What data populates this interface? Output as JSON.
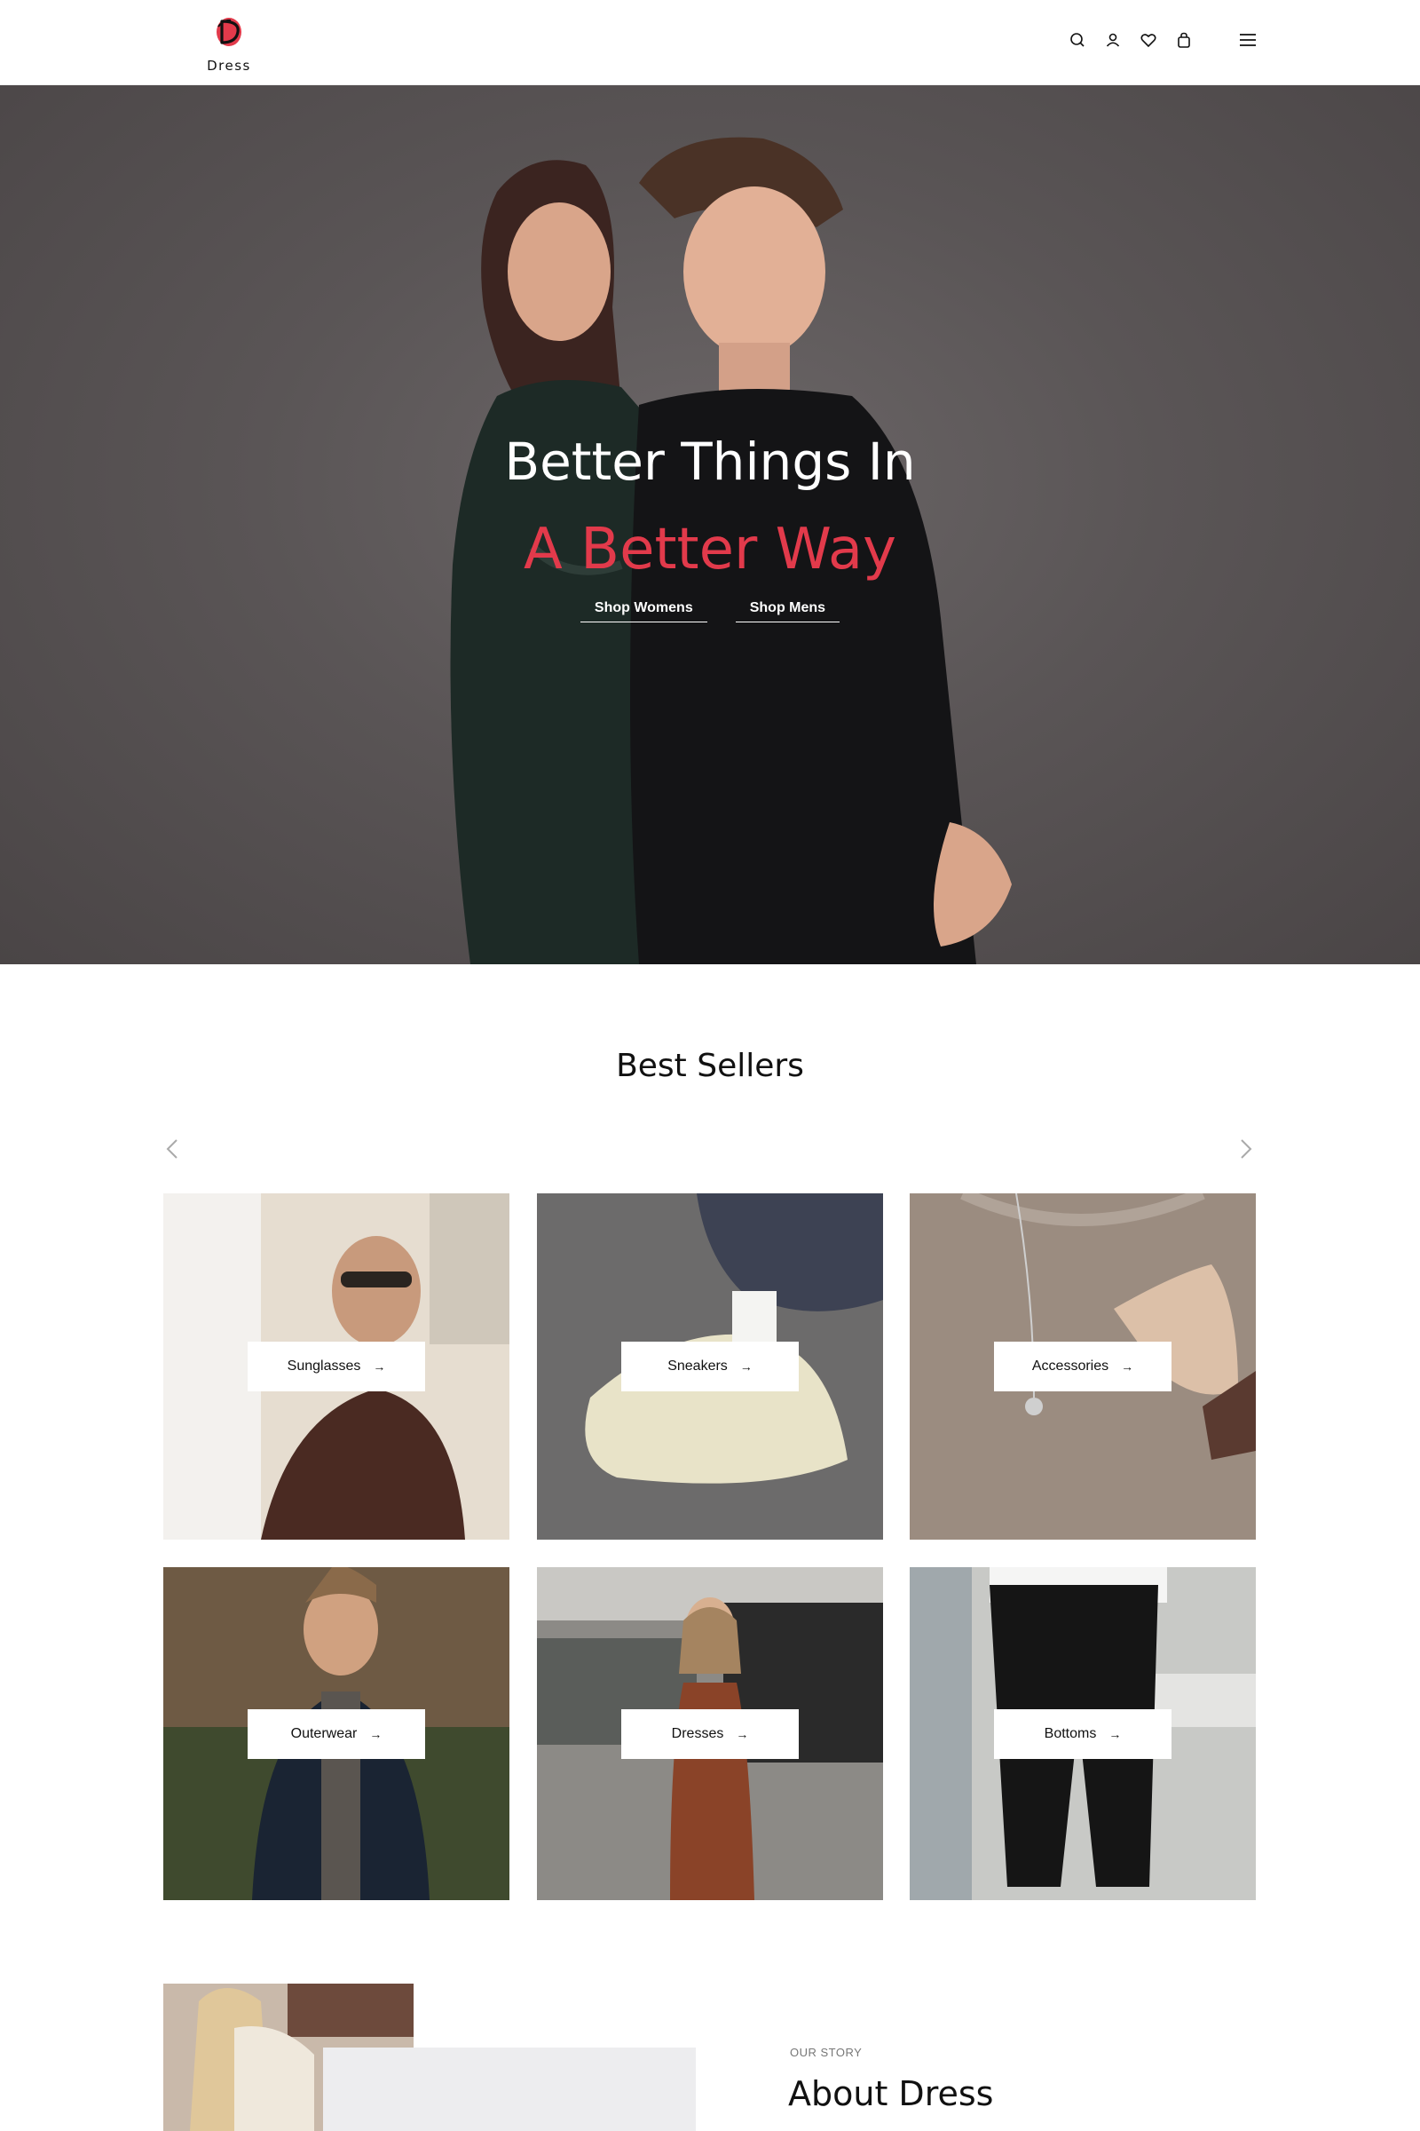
{
  "brand": {
    "name": "Dress",
    "accent": "#e23a4b"
  },
  "header": {
    "icons": [
      "search-icon",
      "user-icon",
      "heart-icon",
      "bag-icon"
    ],
    "menu_icon": "hamburger-menu-icon"
  },
  "hero": {
    "line1": "Better Things In",
    "line2": "A Better Way",
    "links": [
      "Shop Womens",
      "Shop Mens"
    ]
  },
  "best_sellers": {
    "title": "Best Sellers",
    "categories": [
      {
        "label": "Sunglasses"
      },
      {
        "label": "Sneakers"
      },
      {
        "label": "Accessories"
      },
      {
        "label": "Outerwear"
      },
      {
        "label": "Dresses"
      },
      {
        "label": "Bottoms"
      }
    ]
  },
  "about": {
    "eyebrow": "OUR STORY",
    "title": "About Dress"
  }
}
